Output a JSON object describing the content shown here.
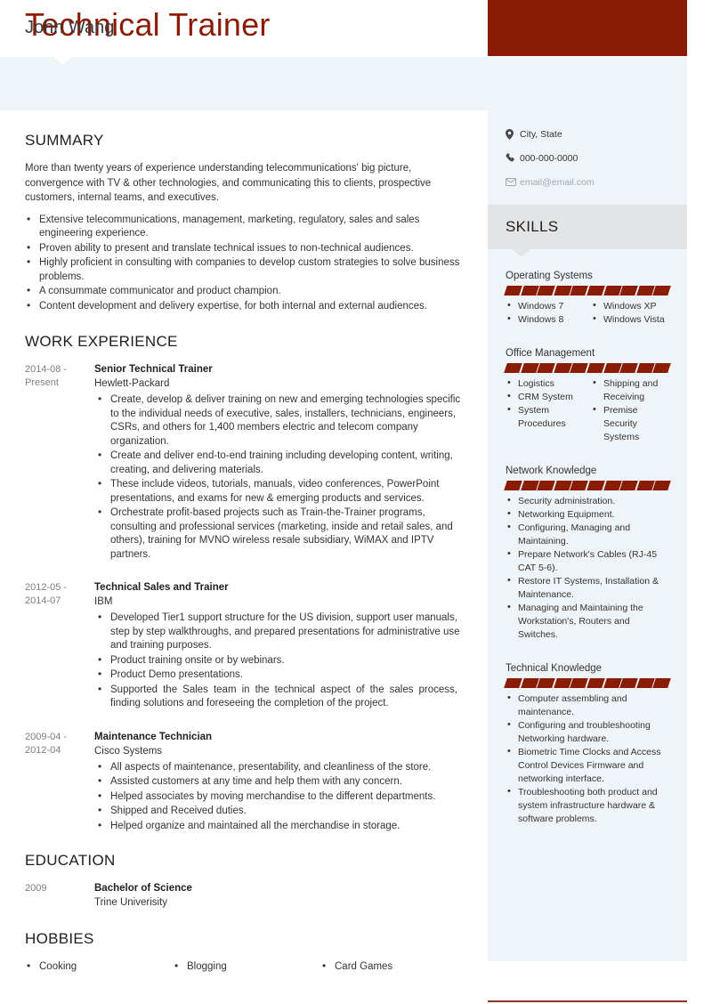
{
  "header": {
    "title": "Technical Trainer",
    "name": "John Wang"
  },
  "colors": {
    "accent": "#8a1c05",
    "sidebar_bg": "#eff4f8",
    "skills_band_bg": "#e2e4e6",
    "bottom_rule": "#8a3a22"
  },
  "contact": {
    "location": {
      "icon": "map-pin-icon",
      "value": "City, State"
    },
    "phone": {
      "icon": "phone-icon",
      "value": "000-000-0000"
    },
    "email": {
      "icon": "envelope-icon",
      "value": "email@email.com"
    }
  },
  "sections": {
    "summary_title": "SUMMARY",
    "work_title": "WORK EXPERIENCE",
    "education_title": "EDUCATION",
    "hobbies_title": "HOBBIES",
    "skills_title": "SKILLS"
  },
  "summary": {
    "paragraph": "More than twenty years of experience understanding telecommunications' big picture, convergence with TV & other technologies, and communicating this to clients, prospective customers, internal teams, and executives.",
    "bullets": [
      "Extensive telecommunications, management, marketing, regulatory, sales and sales engineering experience.",
      "Proven ability to present and translate technical issues to non-technical audiences.",
      "Highly proficient in consulting with companies to develop custom strategies to solve business problems.",
      "A consummate communicator and product champion.",
      "Content development and delivery expertise, for both internal and external audiences."
    ]
  },
  "work": [
    {
      "date": "2014-08 - Present",
      "role": "Senior Technical Trainer",
      "org": "Hewlett-Packard",
      "bullets": [
        "Create, develop & deliver training on new and emerging technologies specific to the individual needs of executive, sales, installers, technicians, engineers, CSRs, and others for 1,400 members electric and telecom company organization.",
        "Create and deliver end-to-end training including developing content, writing, creating, and delivering materials.",
        "These include videos, tutorials, manuals, video conferences, PowerPoint presentations, and exams for new & emerging products and services.",
        "Orchestrate profit-based projects such as Train-the-Trainer programs, consulting and professional services (marketing, inside and retail sales, and others), training for MVNO wireless resale subsidiary, WiMAX and IPTV partners."
      ]
    },
    {
      "date": "2012-05 - 2014-07",
      "role": "Technical Sales and Trainer",
      "org": "IBM",
      "bullets": [
        "Developed Tier1 support structure for the US division, support user manuals, step by step walkthroughs, and prepared presentations for administrative use and training purposes.",
        "Product training onsite or by webinars.",
        "Product Demo presentations.",
        "Supported the Sales team in the technical aspect of the sales process, finding solutions and foreseeing the completion of the project."
      ]
    },
    {
      "date": "2009-04 - 2012-04",
      "role": "Maintenance Technician",
      "org": "Cisco Systems",
      "bullets": [
        "All aspects of maintenance, presentability, and cleanliness of the store.",
        "Assisted customers at any time and help them with any concern.",
        "Helped associates by moving merchandise to the different departments.",
        "Shipped and Received duties.",
        "Helped organize and maintained all the merchandise in storage."
      ]
    }
  ],
  "education": [
    {
      "date": "2009",
      "degree": "Bachelor of Science",
      "school": "Trine Univerisity"
    }
  ],
  "hobbies": [
    "Cooking",
    "Blogging",
    "Card Games"
  ],
  "skills": [
    {
      "name": "Operating Systems",
      "bars_total": 10,
      "bars_filled": 10,
      "columns": [
        [
          "Windows 7",
          "Windows 8"
        ],
        [
          "Windows XP",
          "Windows Vista"
        ]
      ]
    },
    {
      "name": "Office Management",
      "bars_total": 10,
      "bars_filled": 10,
      "columns": [
        [
          "Logistics",
          "CRM System",
          "System Procedures"
        ],
        [
          "Shipping and Receiving",
          "Premise Security Systems"
        ]
      ]
    },
    {
      "name": "Network Knowledge",
      "bars_total": 10,
      "bars_filled": 10,
      "columns": [
        [
          "Security administration.",
          "Networking Equipment.",
          "Configuring, Managing and Maintaining.",
          "Prepare Network's Cables (RJ-45 CAT 5-6).",
          "Restore IT Systems, Installation & Maintenance.",
          "Managing and Maintaining the Workstation's, Routers and Switches."
        ]
      ]
    },
    {
      "name": "Technical Knowledge",
      "bars_total": 10,
      "bars_filled": 10,
      "columns": [
        [
          "Computer assembling and maintenance.",
          "Configuring and troubleshooting Networking hardware.",
          "Biometric Time Clocks and Access Control Devices Firmware and networking interface.",
          "Troubleshooting both product and system infrastructure hardware & software problems."
        ]
      ]
    }
  ]
}
